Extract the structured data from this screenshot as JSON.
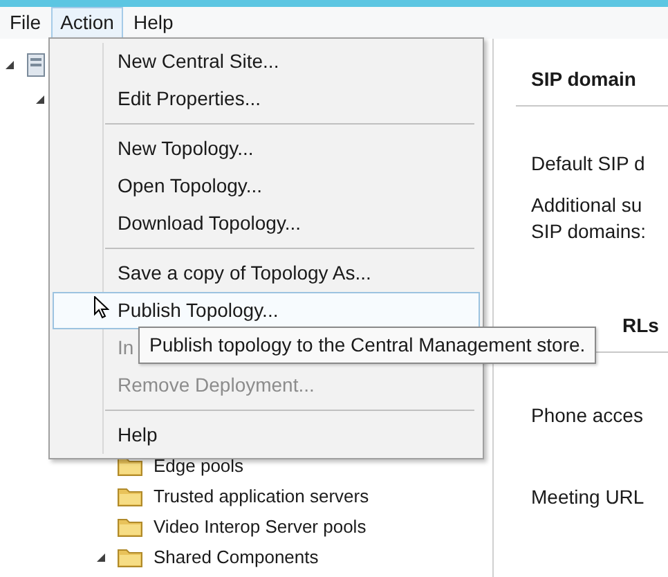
{
  "menubar": [
    {
      "label": "File",
      "selected": false
    },
    {
      "label": "Action",
      "selected": true
    },
    {
      "label": "Help",
      "selected": false
    }
  ],
  "tree": [
    {
      "expanded": true,
      "children": [
        {
          "expanded": true,
          "children": [
            {
              "kind": "folder",
              "label": "Edge pools"
            },
            {
              "kind": "folder",
              "label": "Trusted application servers"
            },
            {
              "kind": "folder",
              "label": "Video Interop Server pools"
            },
            {
              "kind": "group",
              "label": "Shared Components",
              "expanded": true
            }
          ]
        }
      ]
    }
  ],
  "details": [
    {
      "kind": "heading",
      "label": "SIP domain"
    },
    {
      "kind": "field",
      "label": "Default SIP d"
    },
    {
      "kind": "field",
      "label": "Additional su\nSIP domains:"
    },
    {
      "kind": "heading",
      "label": "RLs"
    },
    {
      "kind": "field",
      "label": "Phone acces"
    },
    {
      "kind": "field",
      "label": "Meeting URL"
    }
  ],
  "menu": [
    {
      "kind": "item",
      "label": "New Central Site...",
      "disabled": false,
      "selected": false
    },
    {
      "kind": "item",
      "label": "Edit Properties...",
      "disabled": false,
      "selected": false
    },
    {
      "kind": "separator"
    },
    {
      "kind": "item",
      "label": "New Topology...",
      "disabled": false,
      "selected": false
    },
    {
      "kind": "item",
      "label": "Open Topology...",
      "disabled": false,
      "selected": false
    },
    {
      "kind": "item",
      "label": "Download Topology...",
      "disabled": false,
      "selected": false
    },
    {
      "kind": "separator"
    },
    {
      "kind": "item",
      "label": "Save a copy of Topology As...",
      "disabled": false,
      "selected": false
    },
    {
      "kind": "item",
      "label": "Publish Topology...",
      "disabled": false,
      "selected": true
    },
    {
      "kind": "item",
      "label": "In",
      "disabled": true,
      "selected": false
    },
    {
      "kind": "item",
      "label": "Remove Deployment...",
      "disabled": true,
      "selected": false
    },
    {
      "kind": "separator"
    },
    {
      "kind": "item",
      "label": "Help",
      "disabled": false,
      "selected": false
    }
  ],
  "tooltip": "Publish topology to the Central Management store."
}
